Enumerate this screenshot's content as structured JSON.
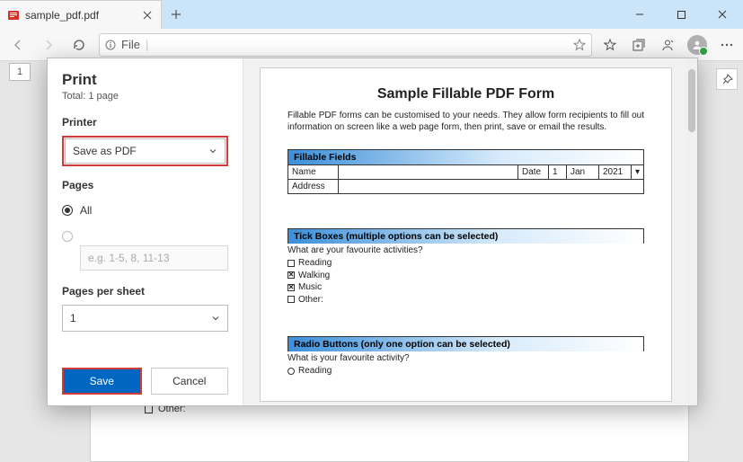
{
  "tab": {
    "title": "sample_pdf.pdf"
  },
  "address": {
    "scheme_label": "File",
    "info_icon": "info-icon"
  },
  "page_thumb": "1",
  "dialog": {
    "title": "Print",
    "total": "Total: 1 page",
    "printer_label": "Printer",
    "printer_value": "Save as PDF",
    "pages_label": "Pages",
    "pages_all": "All",
    "pages_range_placeholder": "e.g. 1-5, 8, 11-13",
    "pps_label": "Pages per sheet",
    "pps_value": "1",
    "save": "Save",
    "cancel": "Cancel"
  },
  "preview": {
    "title": "Sample Fillable PDF Form",
    "intro": "Fillable PDF forms can be customised to your needs. They allow form recipients to fill out information on screen like a web page form, then print, save or email the results.",
    "section_fields": "Fillable Fields",
    "name_label": "Name",
    "address_label": "Address",
    "date_label": "Date",
    "date_day": "1",
    "date_month": "Jan",
    "date_year": "2021",
    "section_tick": "Tick Boxes (multiple options can be selected)",
    "tick_q": "What are your favourite activities?",
    "tick_reading": "Reading",
    "tick_walking": "Walking",
    "tick_music": "Music",
    "tick_other": "Other:",
    "section_radio": "Radio Buttons (only one option can be selected)",
    "radio_q": "What is your favourite activity?",
    "radio_reading": "Reading"
  },
  "behind": {
    "other": "Other:"
  }
}
